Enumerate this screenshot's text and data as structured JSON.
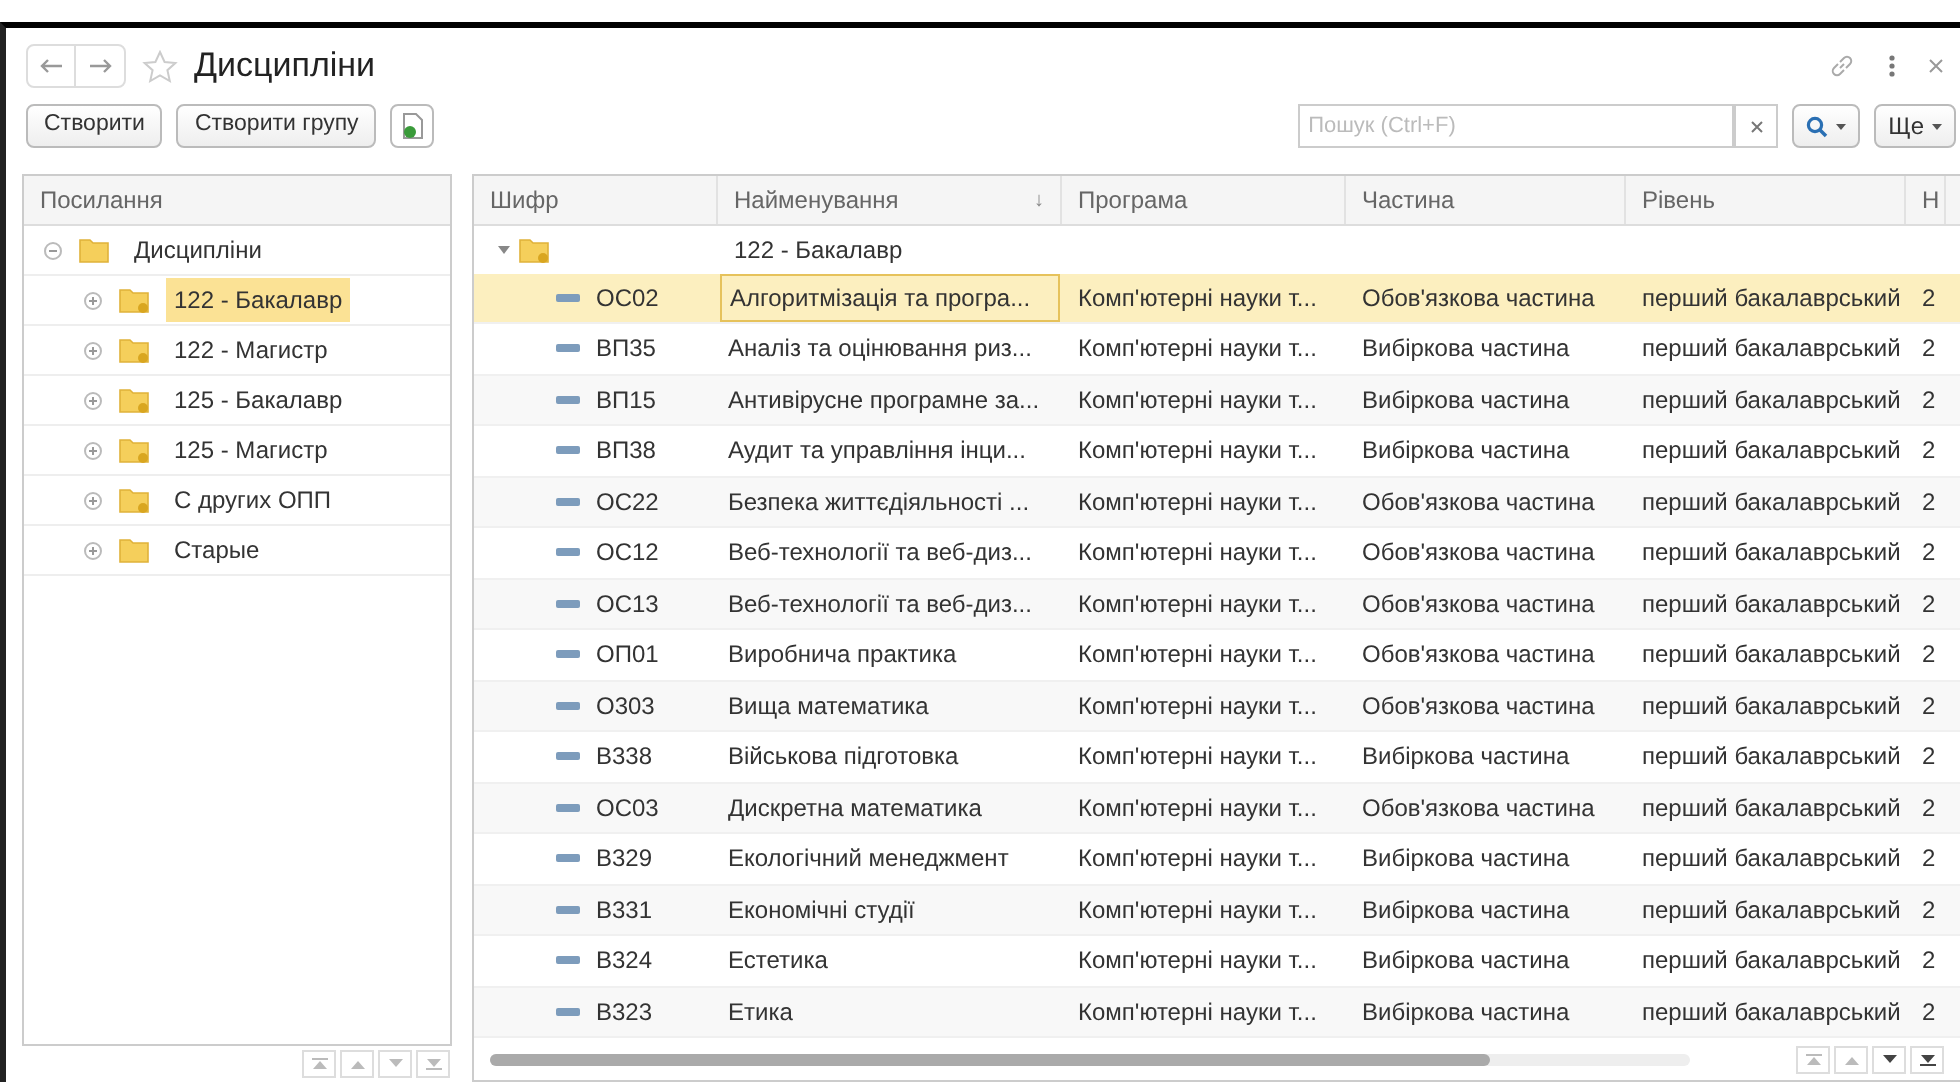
{
  "window": {
    "title": "Дисципліни"
  },
  "toolbar": {
    "buttons": [
      "Створити",
      "Створити групу"
    ],
    "search": {
      "placeholder": "Пошук (Ctrl+F)"
    },
    "more": "Ще"
  },
  "tree": {
    "header": "Посилання",
    "items": [
      {
        "label": "Дисципліни",
        "kind": "plain",
        "expanded": true,
        "selected": false,
        "children": [
          {
            "label": "122 - Бакалавр",
            "kind": "linked",
            "expanded": false,
            "selected": true
          },
          {
            "label": "122 - Магистр",
            "kind": "linked",
            "expanded": false,
            "selected": false
          },
          {
            "label": "125 - Бакалавр",
            "kind": "linked",
            "expanded": false,
            "selected": false
          },
          {
            "label": "125 - Магистр",
            "kind": "linked",
            "expanded": false,
            "selected": false
          },
          {
            "label": "С других ОПП",
            "kind": "linked",
            "expanded": false,
            "selected": false
          },
          {
            "label": "Старые",
            "kind": "plain",
            "expanded": false,
            "selected": false
          }
        ]
      }
    ]
  },
  "table": {
    "columns": [
      {
        "label": "Шифр"
      },
      {
        "label": "Найменування",
        "sort_mark": "↓"
      },
      {
        "label": "Програма"
      },
      {
        "label": "Частина"
      },
      {
        "label": "Рівень"
      },
      {
        "label": "Н"
      }
    ],
    "group_row": {
      "name": "122 - Бакалавр",
      "expanded": true
    },
    "rows": [
      {
        "code": "ОС02",
        "name": "Алгоритмізація та програ...",
        "program": "Комп'ютерні науки т...",
        "part": "Обов'язкова частина",
        "level": "перший бакалаврський",
        "column_6": "2",
        "selected": true
      },
      {
        "code": "ВП35",
        "name": "Аналіз та оцінювання риз...",
        "program": "Комп'ютерні науки т...",
        "part": "Вибіркова частина",
        "level": "перший бакалаврський",
        "column_6": "2",
        "selected": false
      },
      {
        "code": "ВП15",
        "name": "Антивірусне програмне за...",
        "program": "Комп'ютерні науки т...",
        "part": "Вибіркова частина",
        "level": "перший бакалаврський",
        "column_6": "2",
        "selected": false
      },
      {
        "code": "ВП38",
        "name": "Аудит та управління інци...",
        "program": "Комп'ютерні науки т...",
        "part": "Вибіркова частина",
        "level": "перший бакалаврський",
        "column_6": "2",
        "selected": false
      },
      {
        "code": "ОС22",
        "name": "Безпека життєдіяльності ...",
        "program": "Комп'ютерні науки т...",
        "part": "Обов'язкова частина",
        "level": "перший бакалаврський",
        "column_6": "2",
        "selected": false
      },
      {
        "code": "ОС12",
        "name": "Веб-технології та веб-диз...",
        "program": "Комп'ютерні науки т...",
        "part": "Обов'язкова частина",
        "level": "перший бакалаврський",
        "column_6": "2",
        "selected": false
      },
      {
        "code": "ОС13",
        "name": "Веб-технології та веб-диз...",
        "program": "Комп'ютерні науки т...",
        "part": "Обов'язкова частина",
        "level": "перший бакалаврський",
        "column_6": "2",
        "selected": false
      },
      {
        "code": "ОП01",
        "name": "Виробнича практика",
        "program": "Комп'ютерні науки т...",
        "part": "Обов'язкова частина",
        "level": "перший бакалаврський",
        "column_6": "2",
        "selected": false
      },
      {
        "code": "О303",
        "name": "Вища математика",
        "program": "Комп'ютерні науки т...",
        "part": "Обов'язкова частина",
        "level": "перший бакалаврський",
        "column_6": "2",
        "selected": false
      },
      {
        "code": "В338",
        "name": "Військова підготовка",
        "program": "Комп'ютерні науки т...",
        "part": "Вибіркова частина",
        "level": "перший бакалаврський",
        "column_6": "2",
        "selected": false
      },
      {
        "code": "ОС03",
        "name": "Дискретна математика",
        "program": "Комп'ютерні науки т...",
        "part": "Обов'язкова частина",
        "level": "перший бакалаврський",
        "column_6": "2",
        "selected": false
      },
      {
        "code": "В329",
        "name": "Екологічний менеджмент",
        "program": "Комп'ютерні науки т...",
        "part": "Вибіркова частина",
        "level": "перший бакалаврський",
        "column_6": "2",
        "selected": false
      },
      {
        "code": "В331",
        "name": "Економічні студії",
        "program": "Комп'ютерні науки т...",
        "part": "Вибіркова частина",
        "level": "перший бакалаврський",
        "column_6": "2",
        "selected": false
      },
      {
        "code": "В324",
        "name": "Естетика",
        "program": "Комп'ютерні науки т...",
        "part": "Вибіркова частина",
        "level": "перший бакалаврський",
        "column_6": "2",
        "selected": false
      },
      {
        "code": "В323",
        "name": "Етика",
        "program": "Комп'ютерні науки т...",
        "part": "Вибіркова частина",
        "level": "перший бакалаврський",
        "column_6": "2",
        "selected": false
      }
    ]
  }
}
